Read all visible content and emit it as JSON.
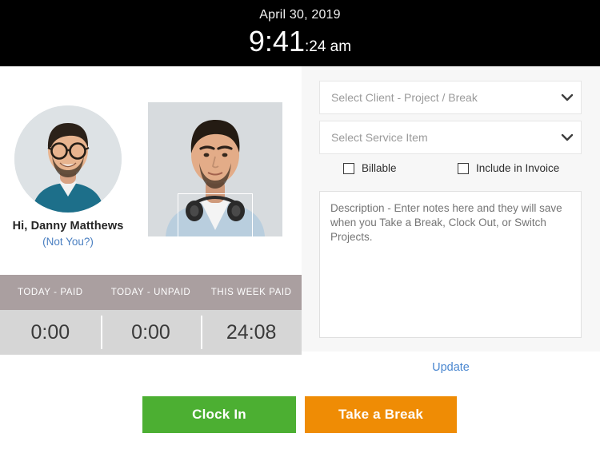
{
  "clock": {
    "date": "April 30, 2019",
    "time_hm": "9:41",
    "time_seconds": ":24",
    "meridiem": " am"
  },
  "user": {
    "greeting": "Hi, Danny Matthews",
    "not_you_label": "(Not You?)",
    "avatar_icon": "user-avatar-photo",
    "webcam_icon": "webcam-live-preview",
    "face_box_icon": "face-detection-box"
  },
  "stats": {
    "columns": [
      {
        "header": "TODAY - PAID",
        "value": "0:00"
      },
      {
        "header": "TODAY - UNPAID",
        "value": "0:00"
      },
      {
        "header": "THIS WEEK PAID",
        "value": "24:08"
      }
    ]
  },
  "form": {
    "client_project_placeholder": "Select Client - Project / Break",
    "service_item_placeholder": "Select Service Item",
    "chevron_icon": "chevron-down-icon",
    "billable_label": "Billable",
    "include_in_invoice_label": "Include in Invoice",
    "description_placeholder": "Description - Enter notes here and they will save when you Take a Break, Clock Out, or Switch Projects.",
    "description_value": "",
    "update_label": "Update"
  },
  "actions": {
    "clock_in_label": "Clock In",
    "take_a_break_label": "Take a Break"
  },
  "colors": {
    "clock_bar": "#000000",
    "stats_header": "#aa9fa0",
    "stats_values": "#d6d6d6",
    "panel_background": "#f7f7f7",
    "link_blue": "#4a87d0",
    "clock_in_green": "#4caf32",
    "take_break_orange": "#ef8c05"
  }
}
